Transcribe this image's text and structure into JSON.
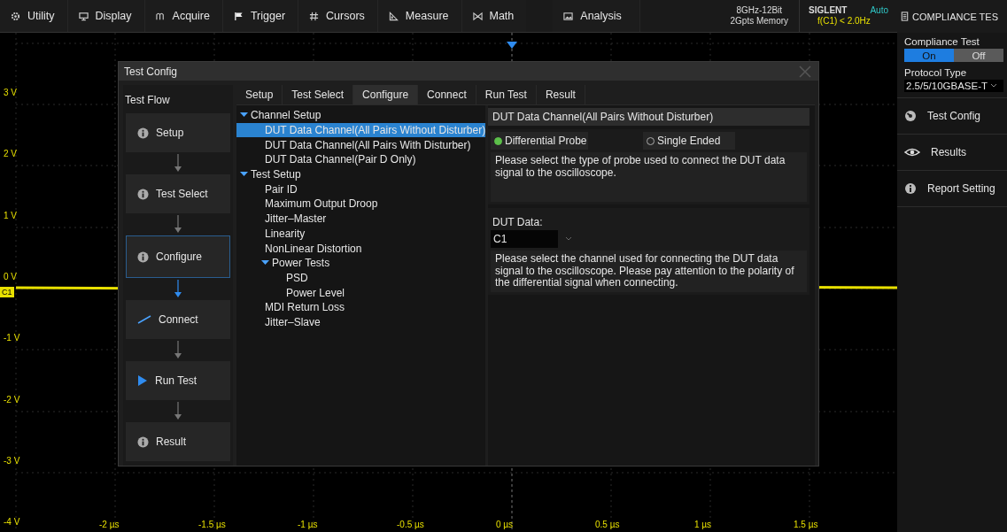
{
  "menu": [
    {
      "label": "Utility"
    },
    {
      "label": "Display"
    },
    {
      "label": "Acquire"
    },
    {
      "label": "Trigger"
    },
    {
      "label": "Cursors"
    },
    {
      "label": "Measure"
    },
    {
      "label": "Math"
    },
    {
      "label": "Analysis"
    }
  ],
  "status": {
    "spec": [
      "8GHz-12Bit",
      "2Gpts Memory"
    ],
    "brand": "SIGLENT",
    "trigger_mode": "Auto",
    "frequency": "f(C1) < 2.0Hz"
  },
  "scope": {
    "channel_tag": "C1",
    "y_labels": [
      "3 V",
      "2 V",
      "1 V",
      "0 V",
      "-1 V",
      "-2 V",
      "-3 V",
      "-4 V"
    ],
    "x_labels": [
      "-2 µs",
      "-1.5 µs",
      "-1 µs",
      "-0.5 µs",
      "0 µs",
      "0.5 µs",
      "1 µs",
      "1.5 µs"
    ]
  },
  "dialog": {
    "title": "Test Config",
    "flow": {
      "title": "Test Flow",
      "steps": [
        {
          "label": "Setup",
          "selected": false
        },
        {
          "label": "Test Select",
          "selected": false
        },
        {
          "label": "Configure",
          "selected": true
        },
        {
          "label": "Connect",
          "selected": false
        },
        {
          "label": "Run Test",
          "selected": false
        },
        {
          "label": "Result",
          "selected": false
        }
      ]
    },
    "tabs": [
      {
        "label": "Setup",
        "selected": false
      },
      {
        "label": "Test Select",
        "selected": false
      },
      {
        "label": "Configure",
        "selected": true
      },
      {
        "label": "Connect",
        "selected": false
      },
      {
        "label": "Run Test",
        "selected": false
      },
      {
        "label": "Result",
        "selected": false
      }
    ],
    "tree": [
      {
        "label": "Channel Setup",
        "expanded": true,
        "selected": false,
        "children": [
          {
            "label": "DUT Data Channel(All Pairs Without Disturber)",
            "selected": true
          },
          {
            "label": "DUT Data Channel(All Pairs With Disturber)",
            "selected": false
          },
          {
            "label": "DUT Data Channel(Pair D Only)",
            "selected": false
          }
        ]
      },
      {
        "label": "Test Setup",
        "expanded": true,
        "selected": false,
        "children": [
          {
            "label": "Pair ID",
            "selected": false
          },
          {
            "label": "Maximum Output Droop",
            "selected": false
          },
          {
            "label": "Jitter–Master",
            "selected": false
          },
          {
            "label": "Linearity",
            "selected": false
          },
          {
            "label": "NonLinear Distortion",
            "selected": false
          },
          {
            "label": "Power Tests",
            "expanded": true,
            "selected": false,
            "children": [
              {
                "label": "PSD",
                "selected": false
              },
              {
                "label": "Power Level",
                "selected": false
              }
            ]
          },
          {
            "label": "MDI Return Loss",
            "selected": false
          },
          {
            "label": "Jitter–Slave",
            "selected": false
          }
        ]
      }
    ],
    "detail": {
      "heading": "DUT Data Channel(All Pairs Without Disturber)",
      "probe_options": [
        {
          "label": "Differential Probe",
          "selected": true
        },
        {
          "label": "Single Ended",
          "selected": false
        }
      ],
      "probe_help": "Please select the type of probe used to connect the DUT data signal to the oscilloscope.",
      "channel_label": "DUT Data:",
      "channel_value": "C1",
      "channel_help": "Please select the channel used for connecting the DUT data signal to the oscilloscope. Please pay attention to the polarity of the differential signal when connecting."
    }
  },
  "side_panel": {
    "title": "COMPLIANCE TES",
    "compliance": {
      "label": "Compliance Test",
      "options": [
        {
          "label": "On",
          "selected": true
        },
        {
          "label": "Off",
          "selected": false
        }
      ]
    },
    "protocol": {
      "label": "Protocol Type",
      "value": "2.5/5/10GBASE-T"
    },
    "items": [
      {
        "label": "Test Config"
      },
      {
        "label": "Results"
      },
      {
        "label": "Report Setting"
      }
    ]
  }
}
